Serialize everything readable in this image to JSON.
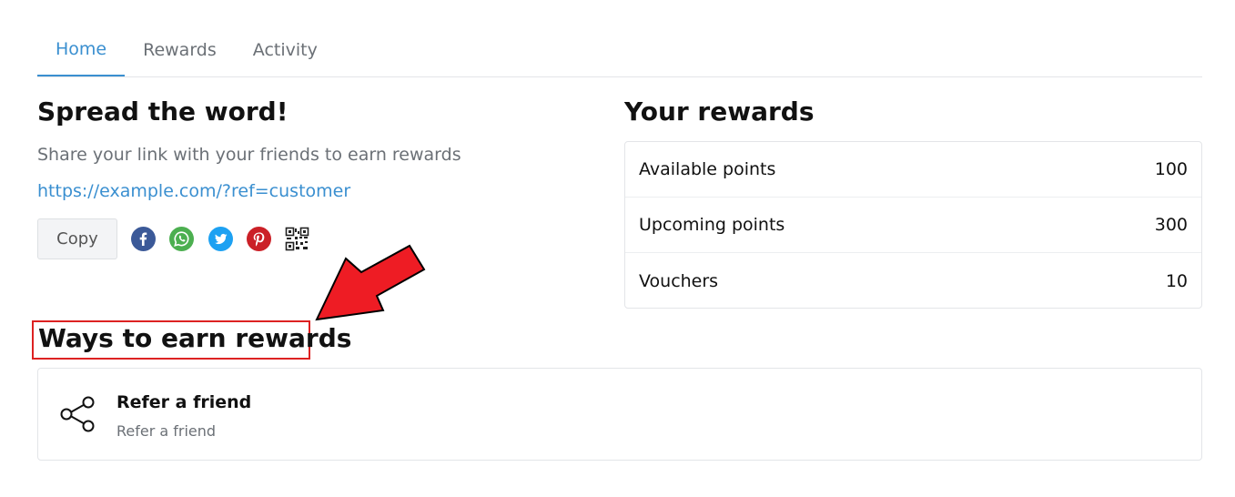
{
  "tabs": [
    {
      "label": "Home",
      "active": true
    },
    {
      "label": "Rewards",
      "active": false
    },
    {
      "label": "Activity",
      "active": false
    }
  ],
  "spread": {
    "title": "Spread the word!",
    "subtitle": "Share your link with your friends to earn rewards",
    "link": "https://example.com/?ref=customer",
    "copy_label": "Copy",
    "share_icons": [
      "facebook-icon",
      "whatsapp-icon",
      "twitter-icon",
      "pinterest-icon",
      "qr-code-icon"
    ]
  },
  "your_rewards": {
    "title": "Your rewards",
    "rows": [
      {
        "label": "Available points",
        "value": "100"
      },
      {
        "label": "Upcoming points",
        "value": "300"
      },
      {
        "label": "Vouchers",
        "value": "10"
      }
    ]
  },
  "ways": {
    "title": "Ways to earn rewards",
    "items": [
      {
        "title": "Refer a friend",
        "description": "Refer a friend",
        "icon": "share-icon"
      }
    ]
  },
  "colors": {
    "accent": "#3a8fd0",
    "annotation": "#ee1c24",
    "facebook": "#3b5998",
    "whatsapp": "#4caf50",
    "twitter": "#1da1f2",
    "pinterest": "#cb2027"
  }
}
